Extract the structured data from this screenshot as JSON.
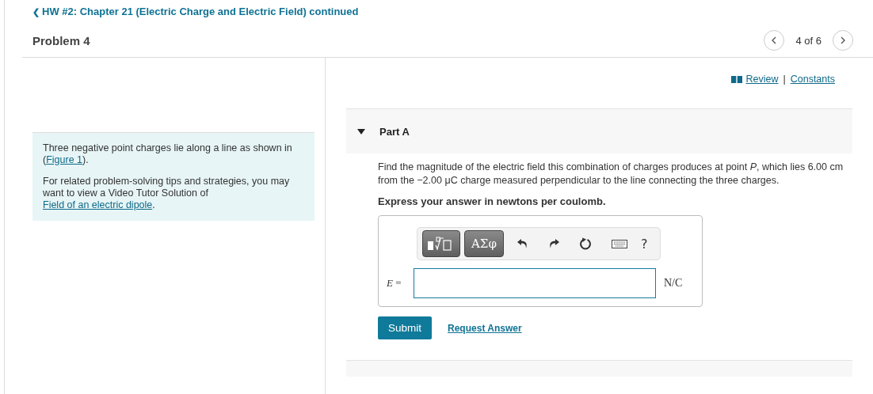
{
  "breadcrumb": {
    "back_icon": "❮",
    "label": "HW #2: Chapter 21 (Electric Charge and Electric Field) continued"
  },
  "problem_title": "Problem 4",
  "pager": {
    "label": "4 of 6"
  },
  "intro": {
    "sentence_before": "Three negative point charges lie along a line as shown in (",
    "figure_link": "Figure 1",
    "sentence_after": ").",
    "tip_text": "For related problem-solving tips and strategies, you may want to view a Video Tutor Solution of",
    "tip_link": "Field of an electric dipole",
    "tip_after": "."
  },
  "resources": {
    "review": "Review",
    "separator": "|",
    "constants": "Constants"
  },
  "part": {
    "title": "Part A",
    "expanded": true,
    "question": "Find the magnitude of the electric field this combination of charges produces at point *P*, which lies 6.00 cm from the −2.00 μC charge measured perpendicular to the line connecting the three charges.",
    "instruction": "Express your answer in newtons per coulomb.",
    "toolbar": {
      "symbols": "ΑΣφ",
      "help": "?"
    },
    "answer": {
      "variable": "E",
      "equals": "=",
      "unit": "N/C"
    },
    "submit": "Submit",
    "request": "Request Answer"
  }
}
